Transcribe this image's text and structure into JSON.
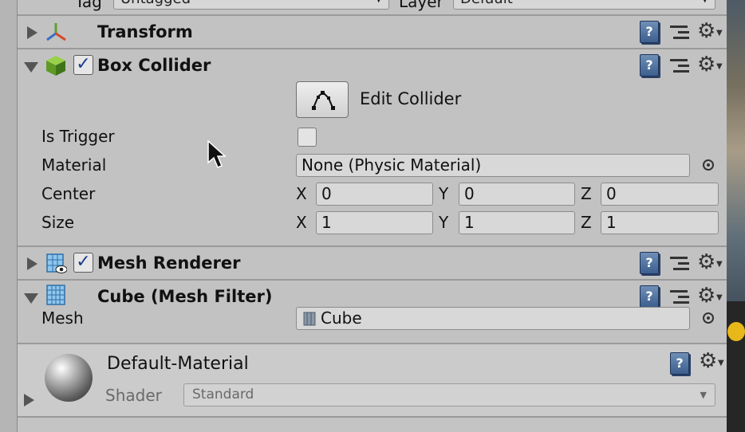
{
  "header": {
    "tag_label": "Tag",
    "tag_value": "Untagged",
    "layer_label": "Layer",
    "layer_value": "Default"
  },
  "components": {
    "transform": {
      "title": "Transform",
      "expanded": false
    },
    "box_collider": {
      "title": "Box Collider",
      "enabled": true,
      "edit_collider_label": "Edit Collider",
      "is_trigger_label": "Is Trigger",
      "is_trigger": false,
      "material_label": "Material",
      "material_value": "None (Physic Material)",
      "center_label": "Center",
      "center": {
        "x_label": "X",
        "x": "0",
        "y_label": "Y",
        "y": "0",
        "z_label": "Z",
        "z": "0"
      },
      "size_label": "Size",
      "size": {
        "x_label": "X",
        "x": "1",
        "y_label": "Y",
        "y": "1",
        "z_label": "Z",
        "z": "1"
      }
    },
    "mesh_renderer": {
      "title": "Mesh Renderer",
      "enabled": true,
      "expanded": false
    },
    "mesh_filter": {
      "title": "Cube (Mesh Filter)",
      "mesh_label": "Mesh",
      "mesh_value": "Cube"
    }
  },
  "material": {
    "name": "Default-Material",
    "shader_label": "Shader",
    "shader_value": "Standard"
  },
  "icons": {
    "help": "help-book-icon",
    "presets": "preset-sliders-icon",
    "settings": "gear-icon",
    "checkmark": "✓"
  },
  "colors": {
    "panel_bg": "#c2c2c2",
    "help_blue": "#4f6f9e",
    "accent_dot": "#e8b81b"
  }
}
